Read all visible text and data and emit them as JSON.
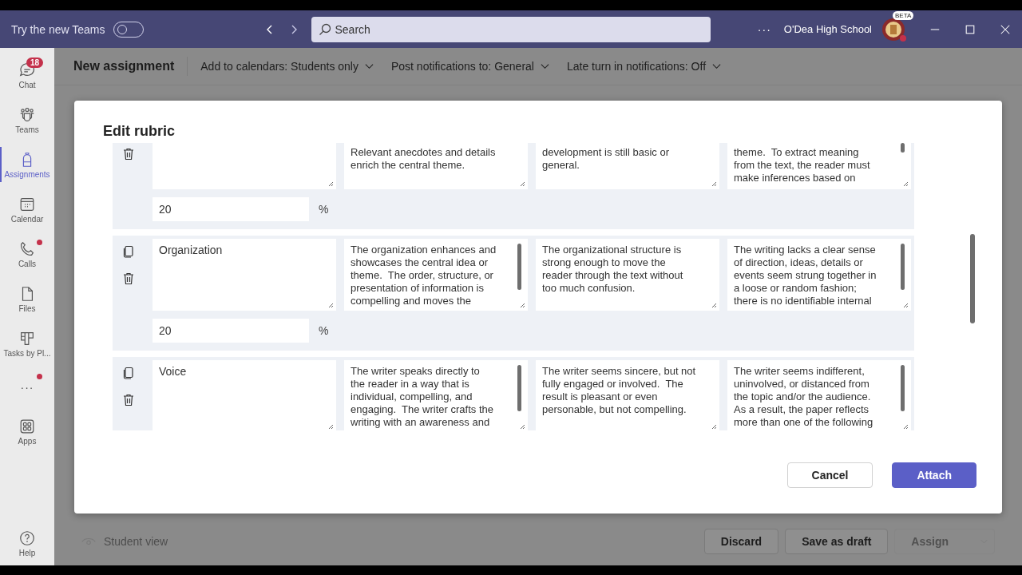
{
  "title_bar": {
    "try_new_label": "Try the new Teams",
    "try_new_on": false,
    "search": {
      "placeholder": "Search"
    },
    "more": "···",
    "org_name": "O'Dea High School",
    "avatar_badge": "BETA"
  },
  "sidebar": {
    "items": [
      {
        "label": "Chat",
        "kind": "app",
        "selected": false,
        "badge": "18",
        "dot": false
      },
      {
        "label": "Teams",
        "kind": "app",
        "selected": false,
        "dot": false
      },
      {
        "label": "Assignments",
        "kind": "app",
        "selected": true,
        "dot": false
      },
      {
        "label": "Calendar",
        "kind": "app",
        "selected": false,
        "dot": false
      },
      {
        "label": "Calls",
        "kind": "app",
        "selected": false,
        "dot": true
      },
      {
        "label": "Files",
        "kind": "app",
        "selected": false,
        "dot": false
      },
      {
        "label": "Tasks by Pl...",
        "kind": "app",
        "selected": false,
        "dot": false
      },
      {
        "label": "···",
        "kind": "overflow",
        "selected": false,
        "dot": true
      },
      {
        "label": "Apps",
        "kind": "app",
        "selected": false,
        "dot": false
      }
    ],
    "help": "Help"
  },
  "header": {
    "title": "New assignment",
    "options": [
      "Add to calendars: Students only",
      "Post notifications to: General",
      "Late turn in notifications: Off"
    ]
  },
  "dialog": {
    "title": "Edit rubric",
    "criteria": [
      {
        "copy_icon": false,
        "weight": "20",
        "unit": "%",
        "descriptors": [
          {
            "text": "Relevant anecdotes and details\nenrich the central theme.",
            "scrollable": false
          },
          {
            "text": "development is still basic or\ngeneral.",
            "scrollable": false
          },
          {
            "text": "theme.  To extract meaning\nfrom the text, the reader must\nmake inferences based on",
            "scrollable": true
          }
        ]
      },
      {
        "name": "Organization",
        "copy_icon": true,
        "weight": "20",
        "unit": "%",
        "descriptors": [
          {
            "text": "The organization enhances and\nshowcases the central idea or\ntheme.  The order, structure, or\npresentation of information is\ncompelling and moves the",
            "scrollable": true
          },
          {
            "text": "The organizational structure is\nstrong enough to move the\nreader through the text without\ntoo much confusion.",
            "scrollable": false
          },
          {
            "text": "The writing lacks a clear sense\nof direction, ideas, details or\nevents seem strung together in\na loose or random fashion;\nthere is no identifiable internal",
            "scrollable": true
          }
        ]
      },
      {
        "name": "Voice",
        "copy_icon": true,
        "descriptors": [
          {
            "text": "The writer speaks directly to\nthe reader in a way that is\nindividual, compelling, and\nengaging.  The writer crafts the\nwriting with an awareness and",
            "scrollable": true
          },
          {
            "text": "The writer seems sincere, but not\nfully engaged or involved.  The\nresult is pleasant or even\npersonable, but not compelling.",
            "scrollable": false
          },
          {
            "text": "The writer seems indifferent,\nuninvolved, or distanced from\nthe topic and/or the audience.\nAs a result, the paper reflects\nmore than one of the following",
            "scrollable": true
          }
        ]
      }
    ],
    "buttons": [
      {
        "label": "Cancel",
        "kind": "secondary"
      },
      {
        "label": "Attach",
        "kind": "primary"
      }
    ]
  },
  "footer": {
    "student_view": "Student view",
    "buttons": [
      {
        "label": "Discard",
        "disabled": false
      },
      {
        "label": "Save as draft",
        "disabled": false
      },
      {
        "label": "Assign",
        "disabled": true
      }
    ]
  }
}
